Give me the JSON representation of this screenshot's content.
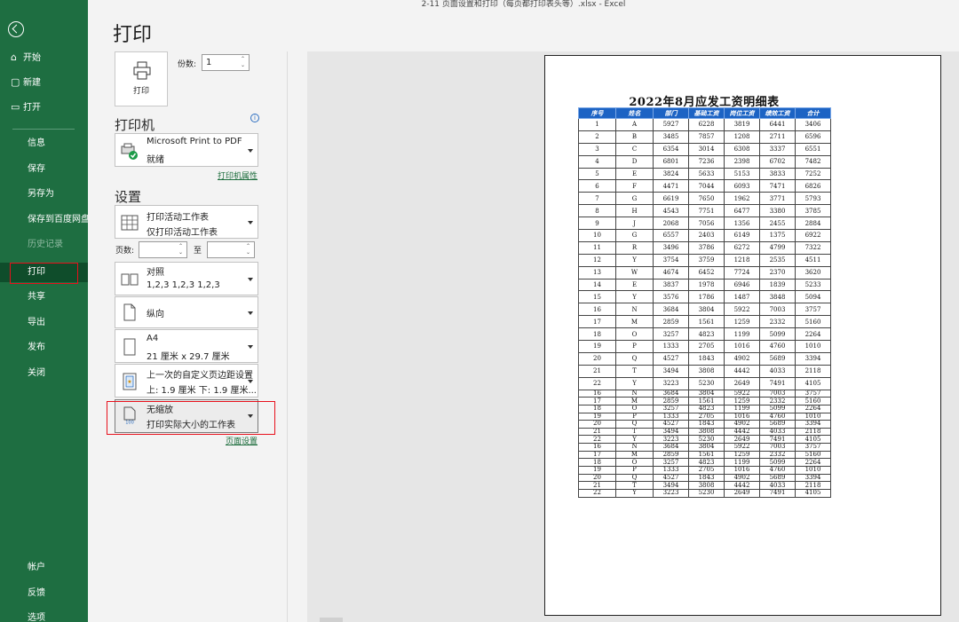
{
  "window_title": "2-11 页面设置和打印（每页都打印表头等）.xlsx  -  Excel",
  "page_title": "打印",
  "nav": {
    "back_icon": "back-arrow-icon",
    "top_items": [
      {
        "label": "开始",
        "icon": "home-icon"
      },
      {
        "label": "新建",
        "icon": "new-file-icon"
      },
      {
        "label": "打开",
        "icon": "open-folder-icon"
      }
    ],
    "mid_items": [
      "信息",
      "保存",
      "另存为",
      "保存到百度网盘",
      "历史记录",
      "打印",
      "共享",
      "导出",
      "发布",
      "关闭"
    ],
    "bottom_items": [
      "帐户",
      "反馈",
      "选项"
    ],
    "active": "打印"
  },
  "print_panel": {
    "print_button_label": "打印",
    "copies_label": "份数:",
    "copies_value": "1",
    "printer_heading": "打印机",
    "printer_name": "Microsoft Print to PDF",
    "printer_status": "就绪",
    "printer_properties_link": "打印机属性",
    "settings_heading": "设置",
    "print_what_line1": "打印活动工作表",
    "print_what_line2": "仅打印活动工作表",
    "pages_label": "页数:",
    "pages_to_label": "至",
    "collate_line1": "对照",
    "collate_line2": "1,2,3    1,2,3    1,2,3",
    "orientation": "纵向",
    "paper_line1": "A4",
    "paper_line2": "21 厘米 x 29.7 厘米",
    "margins_line1": "上一次的自定义页边距设置",
    "margins_line2": "上: 1.9 厘米 下: 1.9 厘米...",
    "scaling_line1": "无缩放",
    "scaling_line2": "打印实际大小的工作表",
    "page_setup_link": "页面设置"
  },
  "sheet": {
    "title": "2022年8月应发工资明细表",
    "headers": [
      "序号",
      "姓名",
      "部门",
      "基础工资",
      "岗位工资",
      "绩效工资",
      "合计"
    ],
    "rows": [
      [
        "1",
        "A",
        "5927",
        "6228",
        "3819",
        "6441",
        "3406"
      ],
      [
        "2",
        "B",
        "3485",
        "7857",
        "1208",
        "2711",
        "6596"
      ],
      [
        "3",
        "C",
        "6354",
        "3014",
        "6308",
        "3337",
        "6551"
      ],
      [
        "4",
        "D",
        "6801",
        "7236",
        "2398",
        "6702",
        "7482"
      ],
      [
        "5",
        "E",
        "3824",
        "5633",
        "5153",
        "3833",
        "7252"
      ],
      [
        "6",
        "F",
        "4471",
        "7044",
        "6093",
        "7471",
        "6826"
      ],
      [
        "7",
        "G",
        "6619",
        "7650",
        "1962",
        "3771",
        "5793"
      ],
      [
        "8",
        "H",
        "4543",
        "7751",
        "6477",
        "3380",
        "3785"
      ],
      [
        "9",
        "J",
        "2068",
        "7056",
        "1356",
        "2455",
        "2884"
      ],
      [
        "10",
        "G",
        "6557",
        "2403",
        "6149",
        "1375",
        "6922"
      ],
      [
        "11",
        "R",
        "3496",
        "3786",
        "6272",
        "4799",
        "7322"
      ],
      [
        "12",
        "Y",
        "3754",
        "3759",
        "1218",
        "2535",
        "4511"
      ],
      [
        "13",
        "W",
        "4674",
        "6452",
        "7724",
        "2370",
        "3620"
      ],
      [
        "14",
        "E",
        "3837",
        "1978",
        "6946",
        "1839",
        "5233"
      ],
      [
        "15",
        "Y",
        "3576",
        "1786",
        "1487",
        "3848",
        "5094"
      ],
      [
        "16",
        "N",
        "3684",
        "3804",
        "5922",
        "7003",
        "3757"
      ],
      [
        "17",
        "M",
        "2859",
        "1561",
        "1259",
        "2332",
        "5160"
      ],
      [
        "18",
        "O",
        "3257",
        "4823",
        "1199",
        "5099",
        "2264"
      ],
      [
        "19",
        "P",
        "1333",
        "2705",
        "1016",
        "4760",
        "1010"
      ],
      [
        "20",
        "Q",
        "4527",
        "1843",
        "4902",
        "5689",
        "3394"
      ],
      [
        "21",
        "T",
        "3494",
        "3808",
        "4442",
        "4033",
        "2118"
      ],
      [
        "22",
        "Y",
        "3223",
        "5230",
        "2649",
        "7491",
        "4105"
      ],
      [
        "16",
        "N",
        "3684",
        "3804",
        "5922",
        "7003",
        "3757"
      ],
      [
        "17",
        "M",
        "2859",
        "1561",
        "1259",
        "2332",
        "5160"
      ],
      [
        "18",
        "O",
        "3257",
        "4823",
        "1199",
        "5099",
        "2264"
      ],
      [
        "19",
        "P",
        "1333",
        "2705",
        "1016",
        "4760",
        "1010"
      ],
      [
        "20",
        "Q",
        "4527",
        "1843",
        "4902",
        "5689",
        "3394"
      ],
      [
        "21",
        "T",
        "3494",
        "3808",
        "4442",
        "4033",
        "2118"
      ],
      [
        "22",
        "Y",
        "3223",
        "5230",
        "2649",
        "7491",
        "4105"
      ],
      [
        "16",
        "N",
        "3684",
        "3804",
        "5922",
        "7003",
        "3757"
      ],
      [
        "17",
        "M",
        "2859",
        "1561",
        "1259",
        "2332",
        "5160"
      ],
      [
        "18",
        "O",
        "3257",
        "4823",
        "1199",
        "5099",
        "2264"
      ],
      [
        "19",
        "P",
        "1333",
        "2705",
        "1016",
        "4760",
        "1010"
      ],
      [
        "20",
        "Q",
        "4527",
        "1843",
        "4902",
        "5689",
        "3394"
      ],
      [
        "21",
        "T",
        "3494",
        "3808",
        "4442",
        "4033",
        "2118"
      ],
      [
        "22",
        "Y",
        "3223",
        "5230",
        "2649",
        "7491",
        "4105"
      ]
    ],
    "tall_row_count": 22
  },
  "colors": {
    "nav_bg": "#1e6e41",
    "header_blue": "#1c63c4",
    "highlight_red": "#e8101c",
    "link_green": "#1a6b3a"
  }
}
